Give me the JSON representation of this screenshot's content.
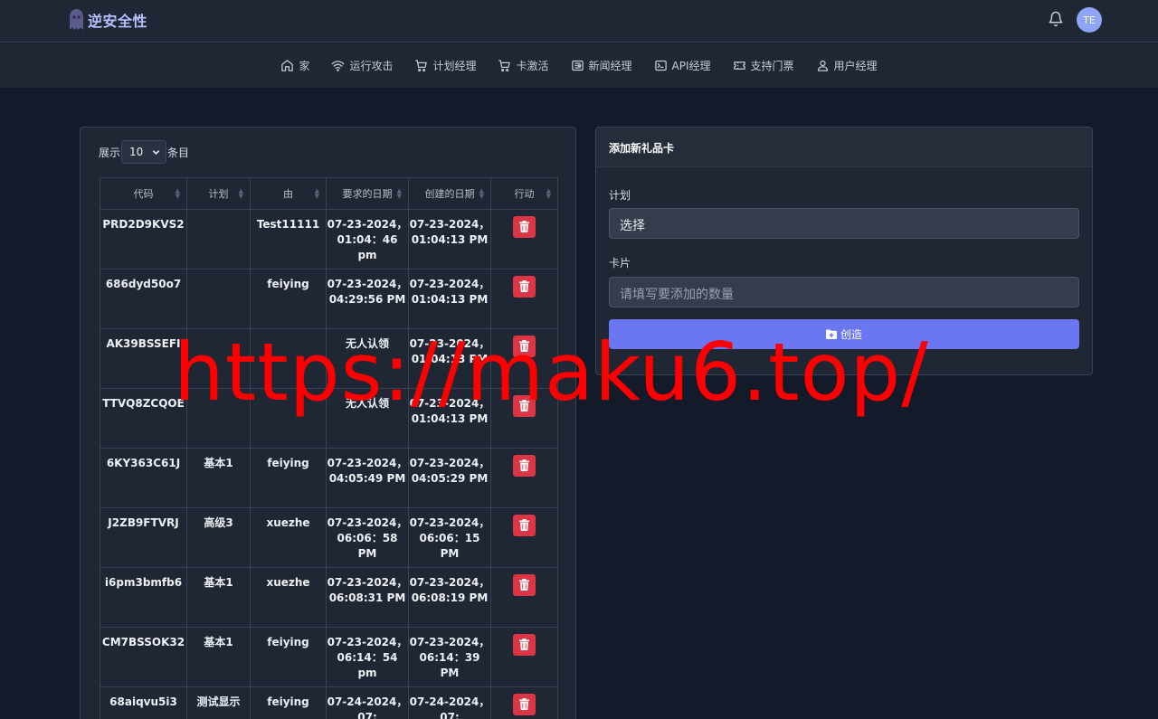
{
  "header": {
    "brand": "逆安全性",
    "avatar_initials": "TE"
  },
  "nav": {
    "items": [
      {
        "label": "家",
        "icon": "home-icon"
      },
      {
        "label": "运行攻击",
        "icon": "wifi-icon"
      },
      {
        "label": "计划经理",
        "icon": "cart-icon"
      },
      {
        "label": "卡激活",
        "icon": "cart-icon"
      },
      {
        "label": "新闻经理",
        "icon": "newspaper-icon"
      },
      {
        "label": "API经理",
        "icon": "terminal-icon"
      },
      {
        "label": "支持门票",
        "icon": "ticket-icon"
      },
      {
        "label": "用户经理",
        "icon": "users-icon"
      }
    ]
  },
  "table": {
    "show_label": "展示",
    "page_size": "10",
    "entries_label": "条目",
    "columns": [
      "代码",
      "计划",
      "由",
      "要求的日期",
      "创建的日期",
      "行动"
    ],
    "rows": [
      {
        "code": "PRD2D9KVS2",
        "plan": "",
        "by": "Test11111",
        "requested": "07-23-2024，01:04：46 pm",
        "created": "07-23-2024，01:04:13 PM"
      },
      {
        "code": "686dyd50o7",
        "plan": "",
        "by": "feiying",
        "requested": "07-23-2024，04:29:56 PM",
        "created": "07-23-2024，01:04:13 PM"
      },
      {
        "code": "AK39BSSEFI",
        "plan": "",
        "by": "",
        "requested": "无人认领",
        "created": "07-23-2024，01:04:13 PM"
      },
      {
        "code": "TTVQ8ZCQOE",
        "plan": "",
        "by": "",
        "requested": "无人认领",
        "created": "07-23-2024，01:04:13 PM"
      },
      {
        "code": "6KY363C61J",
        "plan": "基本1",
        "by": "feiying",
        "requested": "07-23-2024，04:05:49 PM",
        "created": "07-23-2024，04:05:29 PM"
      },
      {
        "code": "J2ZB9FTVRJ",
        "plan": "高级3",
        "by": "xuezhe",
        "requested": "07-23-2024，06:06：58 PM",
        "created": "07-23-2024，06:06：15 PM"
      },
      {
        "code": "i6pm3bmfb6",
        "plan": "基本1",
        "by": "xuezhe",
        "requested": "07-23-2024，06:08:31 PM",
        "created": "07-23-2024，06:08:19 PM"
      },
      {
        "code": "CM7BSSOK32",
        "plan": "基本1",
        "by": "feiying",
        "requested": "07-23-2024，06:14：54 pm",
        "created": "07-23-2024，06:14：39 PM"
      },
      {
        "code": "68aiqvu5i3",
        "plan": "测试显示",
        "by": "feiying",
        "requested": "07-24-2024，07:",
        "created": "07-24-2024，07:"
      }
    ]
  },
  "form": {
    "title": "添加新礼品卡",
    "plan_label": "计划",
    "plan_value": "选择",
    "cards_label": "卡片",
    "cards_placeholder": "请填写要添加的数量",
    "create_label": "创造"
  },
  "watermark": "https://maku6.top/",
  "colors": {
    "background": "#131a29",
    "panel": "#1f2634",
    "accent": "#6b76f2",
    "danger": "#dc3545",
    "brand": "#b6c2ff"
  }
}
